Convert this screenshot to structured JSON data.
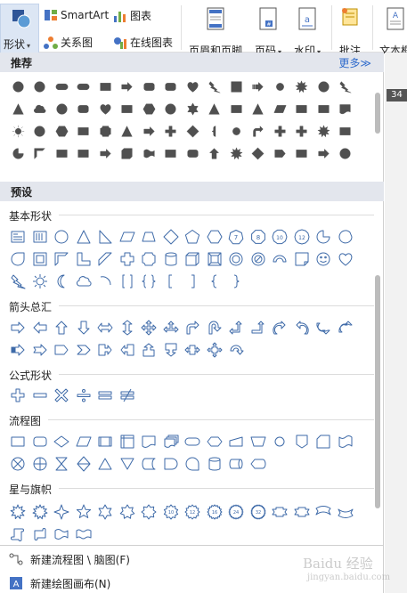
{
  "ribbon": {
    "shape_label": "形状",
    "smartart_label": "SmartArt",
    "chart_label": "图表",
    "relation_label": "关系图",
    "online_chart_label": "在线图表",
    "header_footer_label": "页眉和页脚",
    "page_number_label": "页码",
    "watermark_label": "水印",
    "comment_label": "批注",
    "textbox_label": "文本框"
  },
  "panel": {
    "recommended_title": "推荐",
    "more_label": "更多≫",
    "preset_title": "预设",
    "categories": {
      "basic": "基本形状",
      "arrows": "箭头总汇",
      "formula": "公式形状",
      "flowchart": "流程图",
      "stars": "星与旗帜"
    },
    "footer": {
      "new_flowchart": "新建流程图 \\ 脑图(F)",
      "new_canvas": "新建绘图画布(N)"
    }
  },
  "side": {
    "page_number": "34"
  },
  "watermark": {
    "text": "Baidu 经验",
    "sub": "jingyan.baidu.com"
  },
  "colors": {
    "accent": "#4472c4",
    "shape_outline": "#3e6aa8",
    "recommended_fill": "#505050",
    "header_bg": "#e3e6ed"
  },
  "icons": {
    "recommended_count": 75,
    "basic": [
      "text-box",
      "vertical-text-box",
      "oval",
      "triangle",
      "right-triangle",
      "parallelogram",
      "trapezoid",
      "diamond",
      "pentagon",
      "hexagon",
      "heptagon",
      "octagon",
      "decagon",
      "dodecagon",
      "pie",
      "chord",
      "teardrop",
      "frame",
      "half-frame",
      "l-shape",
      "diagonal-stripe",
      "cross",
      "plaque",
      "can",
      "cube",
      "bevel",
      "donut",
      "no-symbol",
      "block-arc",
      "folded-corner",
      "smiley-face",
      "heart",
      "lightning-bolt",
      "sun",
      "moon",
      "cloud",
      "arc",
      "double-bracket",
      "double-brace",
      "left-bracket",
      "right-bracket",
      "left-brace",
      "right-brace"
    ],
    "arrows": [
      "right-arrow",
      "left-arrow",
      "up-arrow",
      "down-arrow",
      "left-right-arrow",
      "up-down-arrow",
      "quad-arrow",
      "left-right-up-arrow",
      "bent-arrow",
      "u-turn-arrow",
      "left-up-arrow",
      "bent-up-arrow",
      "curved-right-arrow",
      "curved-left-arrow",
      "curved-up-arrow",
      "curved-down-arrow",
      "striped-right-arrow",
      "notched-right-arrow",
      "pentagon-arrow",
      "chevron",
      "right-arrow-callout",
      "left-arrow-callout",
      "up-arrow-callout",
      "down-arrow-callout",
      "left-right-arrow-callout",
      "quad-arrow-callout",
      "circular-arrow"
    ],
    "formula": [
      "plus",
      "minus",
      "multiply",
      "divide",
      "equal",
      "not-equal"
    ],
    "flowchart": [
      "process",
      "alternate-process",
      "decision",
      "data",
      "predefined-process",
      "internal-storage",
      "document",
      "multidocument",
      "terminator",
      "preparation",
      "manual-input",
      "manual-operation",
      "connector",
      "off-page-connector",
      "card",
      "punched-tape",
      "summing-junction",
      "or",
      "collate",
      "sort",
      "extract",
      "merge",
      "stored-data",
      "delay",
      "sequential-storage",
      "magnetic-disk",
      "direct-storage",
      "display"
    ],
    "stars": [
      "explosion-1",
      "explosion-2",
      "star-4",
      "star-5",
      "star-6",
      "star-7",
      "star-8",
      "star-10",
      "star-12",
      "star-16",
      "star-24",
      "star-32",
      "up-ribbon",
      "down-ribbon",
      "curved-up-ribbon",
      "curved-down-ribbon",
      "vertical-scroll",
      "horizontal-scroll",
      "wave",
      "double-wave"
    ]
  }
}
